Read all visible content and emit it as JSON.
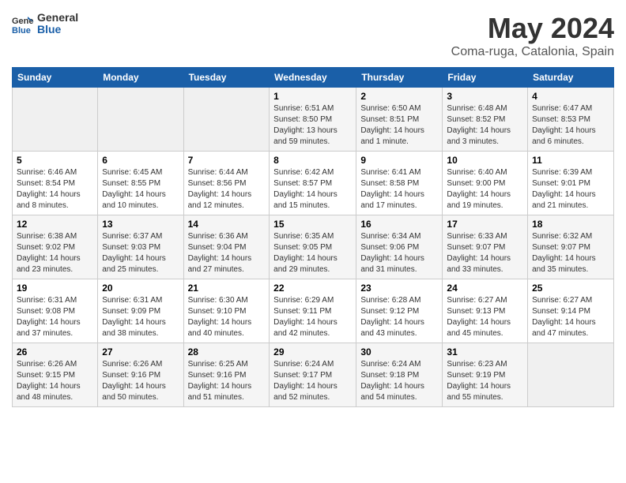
{
  "header": {
    "logo_line1": "General",
    "logo_line2": "Blue",
    "title": "May 2024",
    "subtitle": "Coma-ruga, Catalonia, Spain"
  },
  "days_of_week": [
    "Sunday",
    "Monday",
    "Tuesday",
    "Wednesday",
    "Thursday",
    "Friday",
    "Saturday"
  ],
  "weeks": [
    [
      {
        "day": "",
        "info": ""
      },
      {
        "day": "",
        "info": ""
      },
      {
        "day": "",
        "info": ""
      },
      {
        "day": "1",
        "info": "Sunrise: 6:51 AM\nSunset: 8:50 PM\nDaylight: 13 hours and 59 minutes."
      },
      {
        "day": "2",
        "info": "Sunrise: 6:50 AM\nSunset: 8:51 PM\nDaylight: 14 hours and 1 minute."
      },
      {
        "day": "3",
        "info": "Sunrise: 6:48 AM\nSunset: 8:52 PM\nDaylight: 14 hours and 3 minutes."
      },
      {
        "day": "4",
        "info": "Sunrise: 6:47 AM\nSunset: 8:53 PM\nDaylight: 14 hours and 6 minutes."
      }
    ],
    [
      {
        "day": "5",
        "info": "Sunrise: 6:46 AM\nSunset: 8:54 PM\nDaylight: 14 hours and 8 minutes."
      },
      {
        "day": "6",
        "info": "Sunrise: 6:45 AM\nSunset: 8:55 PM\nDaylight: 14 hours and 10 minutes."
      },
      {
        "day": "7",
        "info": "Sunrise: 6:44 AM\nSunset: 8:56 PM\nDaylight: 14 hours and 12 minutes."
      },
      {
        "day": "8",
        "info": "Sunrise: 6:42 AM\nSunset: 8:57 PM\nDaylight: 14 hours and 15 minutes."
      },
      {
        "day": "9",
        "info": "Sunrise: 6:41 AM\nSunset: 8:58 PM\nDaylight: 14 hours and 17 minutes."
      },
      {
        "day": "10",
        "info": "Sunrise: 6:40 AM\nSunset: 9:00 PM\nDaylight: 14 hours and 19 minutes."
      },
      {
        "day": "11",
        "info": "Sunrise: 6:39 AM\nSunset: 9:01 PM\nDaylight: 14 hours and 21 minutes."
      }
    ],
    [
      {
        "day": "12",
        "info": "Sunrise: 6:38 AM\nSunset: 9:02 PM\nDaylight: 14 hours and 23 minutes."
      },
      {
        "day": "13",
        "info": "Sunrise: 6:37 AM\nSunset: 9:03 PM\nDaylight: 14 hours and 25 minutes."
      },
      {
        "day": "14",
        "info": "Sunrise: 6:36 AM\nSunset: 9:04 PM\nDaylight: 14 hours and 27 minutes."
      },
      {
        "day": "15",
        "info": "Sunrise: 6:35 AM\nSunset: 9:05 PM\nDaylight: 14 hours and 29 minutes."
      },
      {
        "day": "16",
        "info": "Sunrise: 6:34 AM\nSunset: 9:06 PM\nDaylight: 14 hours and 31 minutes."
      },
      {
        "day": "17",
        "info": "Sunrise: 6:33 AM\nSunset: 9:07 PM\nDaylight: 14 hours and 33 minutes."
      },
      {
        "day": "18",
        "info": "Sunrise: 6:32 AM\nSunset: 9:07 PM\nDaylight: 14 hours and 35 minutes."
      }
    ],
    [
      {
        "day": "19",
        "info": "Sunrise: 6:31 AM\nSunset: 9:08 PM\nDaylight: 14 hours and 37 minutes."
      },
      {
        "day": "20",
        "info": "Sunrise: 6:31 AM\nSunset: 9:09 PM\nDaylight: 14 hours and 38 minutes."
      },
      {
        "day": "21",
        "info": "Sunrise: 6:30 AM\nSunset: 9:10 PM\nDaylight: 14 hours and 40 minutes."
      },
      {
        "day": "22",
        "info": "Sunrise: 6:29 AM\nSunset: 9:11 PM\nDaylight: 14 hours and 42 minutes."
      },
      {
        "day": "23",
        "info": "Sunrise: 6:28 AM\nSunset: 9:12 PM\nDaylight: 14 hours and 43 minutes."
      },
      {
        "day": "24",
        "info": "Sunrise: 6:27 AM\nSunset: 9:13 PM\nDaylight: 14 hours and 45 minutes."
      },
      {
        "day": "25",
        "info": "Sunrise: 6:27 AM\nSunset: 9:14 PM\nDaylight: 14 hours and 47 minutes."
      }
    ],
    [
      {
        "day": "26",
        "info": "Sunrise: 6:26 AM\nSunset: 9:15 PM\nDaylight: 14 hours and 48 minutes."
      },
      {
        "day": "27",
        "info": "Sunrise: 6:26 AM\nSunset: 9:16 PM\nDaylight: 14 hours and 50 minutes."
      },
      {
        "day": "28",
        "info": "Sunrise: 6:25 AM\nSunset: 9:16 PM\nDaylight: 14 hours and 51 minutes."
      },
      {
        "day": "29",
        "info": "Sunrise: 6:24 AM\nSunset: 9:17 PM\nDaylight: 14 hours and 52 minutes."
      },
      {
        "day": "30",
        "info": "Sunrise: 6:24 AM\nSunset: 9:18 PM\nDaylight: 14 hours and 54 minutes."
      },
      {
        "day": "31",
        "info": "Sunrise: 6:23 AM\nSunset: 9:19 PM\nDaylight: 14 hours and 55 minutes."
      },
      {
        "day": "",
        "info": ""
      }
    ]
  ]
}
